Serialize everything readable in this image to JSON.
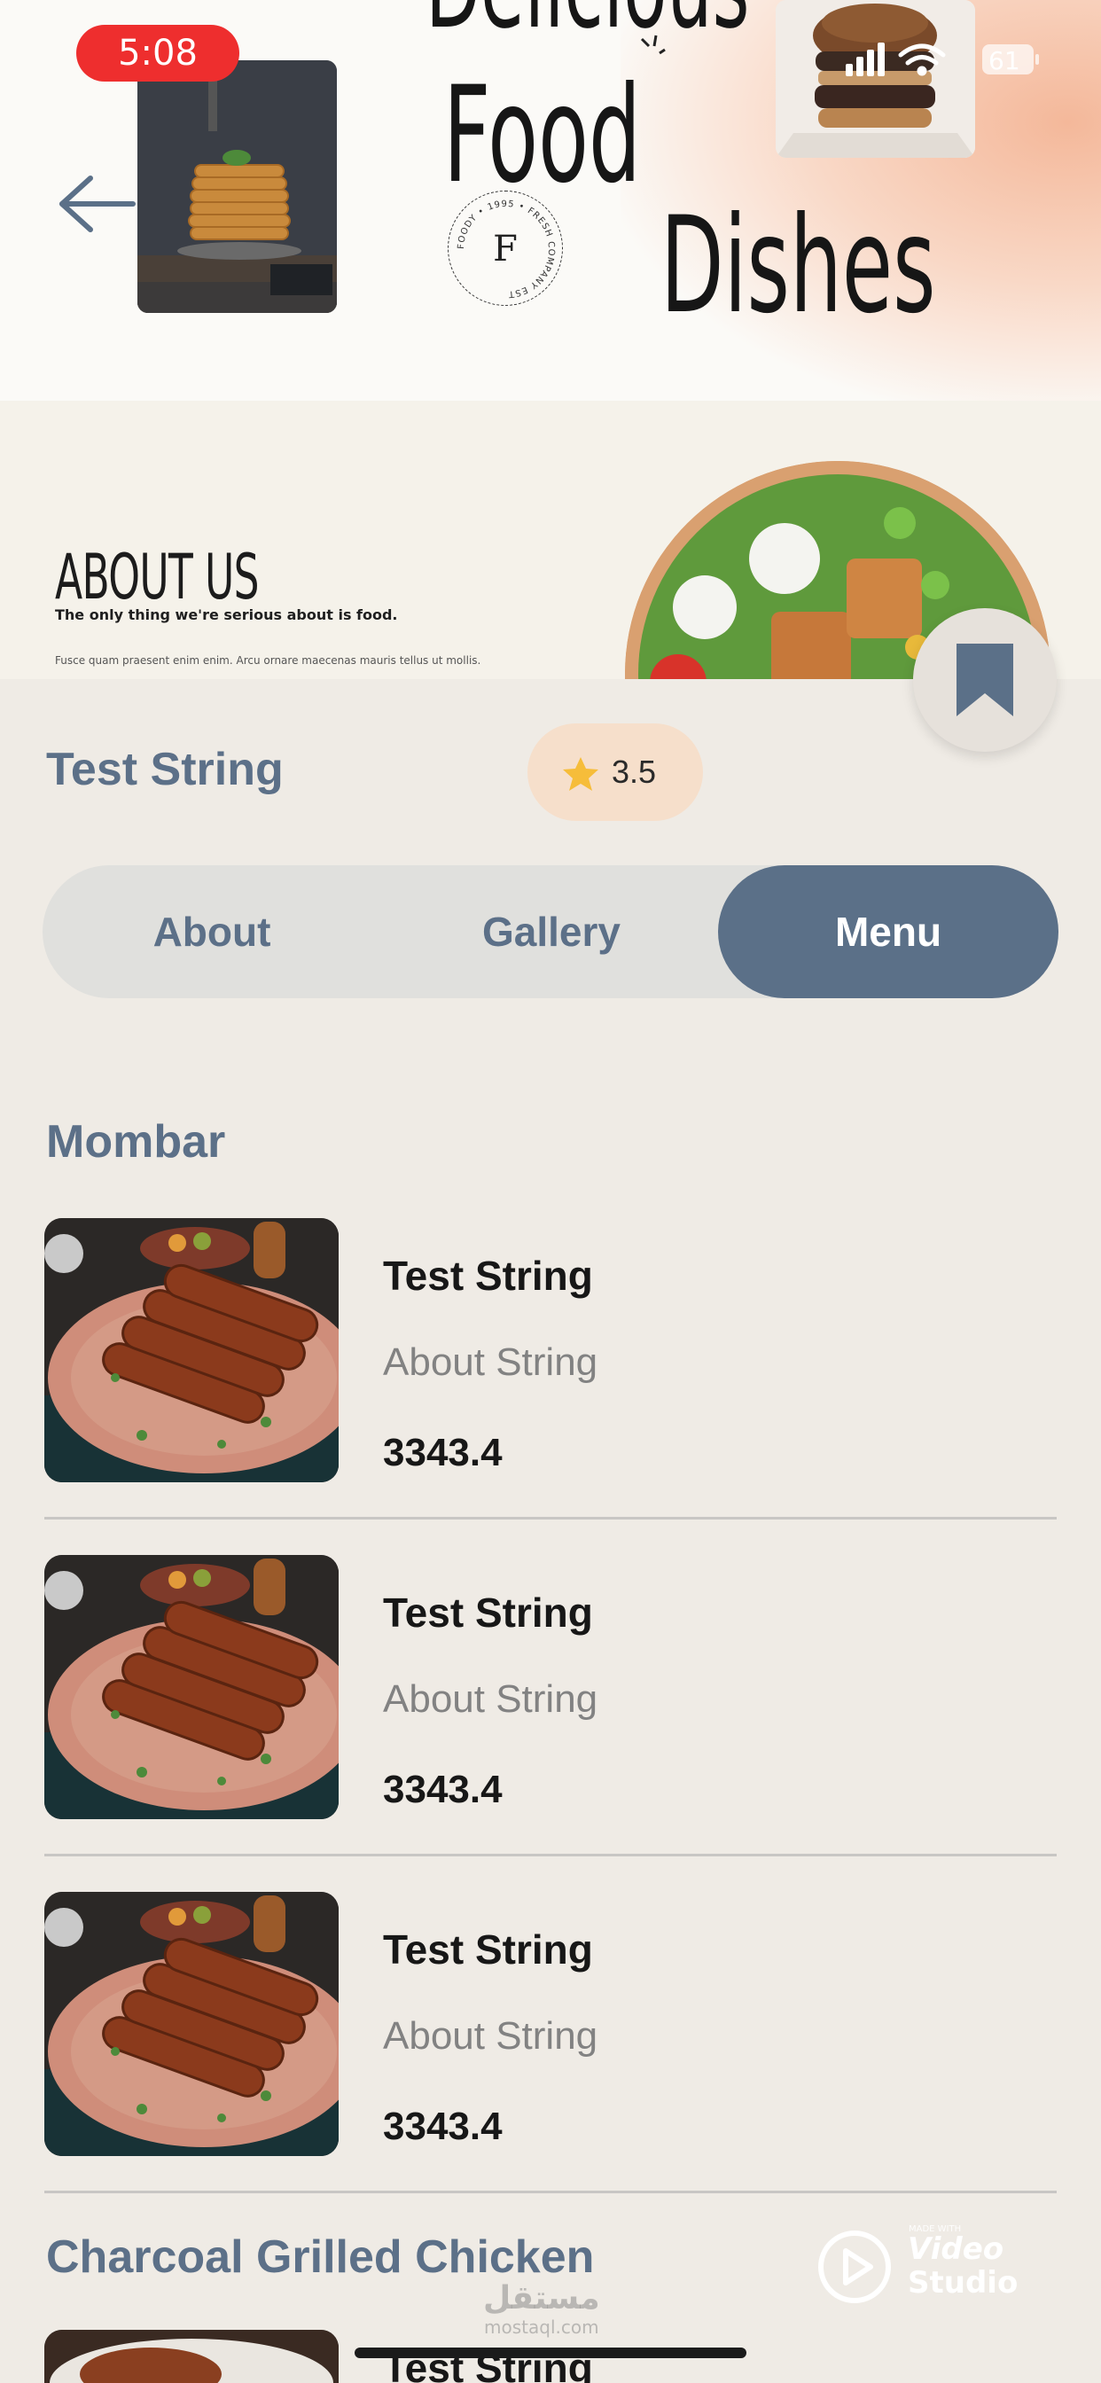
{
  "status_bar": {
    "time": "5:08",
    "battery": "61"
  },
  "hero": {
    "title_top": "Delicious",
    "title_line1": "Food",
    "title_line2": "Dishes",
    "logo_letter": "F",
    "logo_ring_text": "FOODY • 1995 • FRESH COMPANY EST",
    "about_heading": "ABOUT US",
    "about_sub": "The only thing we're serious about is food.",
    "about_lorem": "Fusce quam praesent enim enim. Arcu ornare maecenas mauris tellus ut mollis."
  },
  "restaurant": {
    "name": "Test String",
    "rating": "3.5"
  },
  "tabs": [
    {
      "label": "About",
      "active": false
    },
    {
      "label": "Gallery",
      "active": false
    },
    {
      "label": "Menu",
      "active": true
    }
  ],
  "menu": {
    "sections": [
      {
        "title": "Mombar",
        "items": [
          {
            "name": "Test String",
            "description": "About String",
            "price": "3343.4"
          },
          {
            "name": "Test String",
            "description": "About String",
            "price": "3343.4"
          },
          {
            "name": "Test String",
            "description": "About String",
            "price": "3343.4"
          }
        ]
      },
      {
        "title": "Charcoal Grilled Chicken",
        "items": [
          {
            "name": "Test String"
          }
        ]
      }
    ]
  },
  "watermarks": {
    "mostaql_ar": "مستقل",
    "mostaql_en": "mostaql.com",
    "vs_small": "MADE WITH",
    "vs_line1": "Video",
    "vs_line2": "Studio"
  },
  "colors": {
    "accent": "#5b7088",
    "background": "#efebe5",
    "rating_pill": "#f6dfcb",
    "star": "#f6bd3a",
    "status_time_bg": "#ee2e2e"
  },
  "icons": [
    "back-arrow-icon",
    "bookmark-icon",
    "star-icon",
    "signal-icon",
    "wifi-icon",
    "battery-icon",
    "play-icon"
  ]
}
